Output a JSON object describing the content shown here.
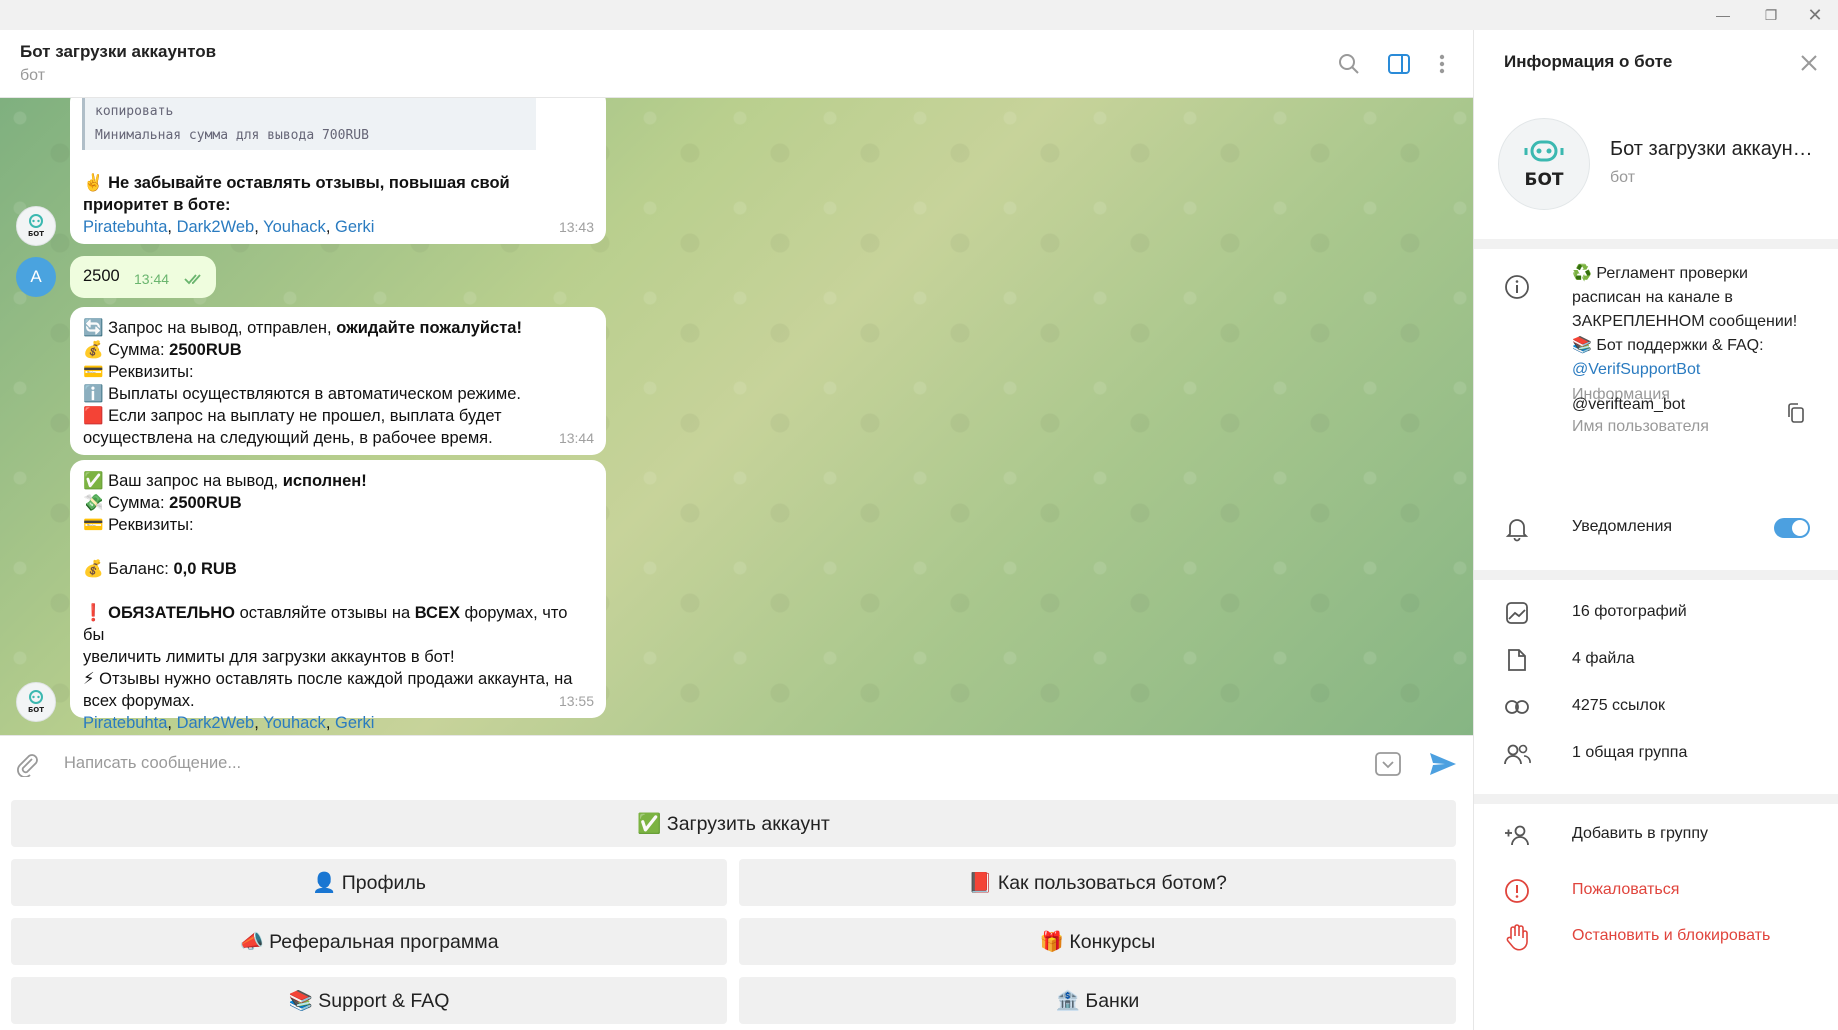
{
  "chat": {
    "title": "Бот загрузки аккаунтов",
    "subtitle": "бот"
  },
  "messages": {
    "m1": {
      "code_top": "копировать",
      "code_bottom": "Минимальная сумма для вывода 700RUB",
      "line1": "✌️ Не забывайте оставлять отзывы, повышая свой",
      "line2": "приоритет в боте:",
      "links": [
        "Piratebuhta",
        "Dark2Web",
        "Youhack",
        "Gerki"
      ],
      "time": "13:43"
    },
    "m2": {
      "text": "2500",
      "time": "13:44"
    },
    "m3": {
      "l1a": "🔄 Запрос на вывод,  отправлен, ",
      "l1b": "ожидайте пожалуйста!",
      "l2a": "💰 Сумма: ",
      "l2b": "2500RUB",
      "l3": "💳 Реквизиты: ",
      "l4": "ℹ️ Выплаты осуществляются в автоматическом режиме.",
      "l5": "🟥 Если запрос на выплату не прошел, выплата будет",
      "l6": "осуществлена на следующий день, в рабочее время.",
      "time": "13:44"
    },
    "m4": {
      "l1a": "✅ Ваш запрос на вывод, ",
      "l1b": "исполнен!",
      "l2a": "💸 Сумма: ",
      "l2b": "2500RUB",
      "l3": "💳 Реквизиты: ",
      "l4a": "💰 Баланс: ",
      "l4b": "0,0 RUB",
      "l5a": "❗ ",
      "l5b": "ОБЯЗАТЕЛЬНО",
      "l5c": " оставляйте отзывы на ",
      "l5d": "ВСЕХ",
      "l5e": " форумах, что бы",
      "l6": "увеличить лимиты для загрузки аккаунтов в бот!",
      "l7": "⚡ Отзывы нужно оставлять после каждой продажи аккаунта, на",
      "l8": "всех форумах.",
      "links": [
        "Piratebuhta",
        "Dark2Web",
        "Youhack",
        "Gerki"
      ],
      "time": "13:55"
    }
  },
  "user_avatar_letter": "A",
  "bot_avatar_text": "БОТ",
  "input": {
    "placeholder": "Написать сообщение..."
  },
  "keyboard": {
    "upload": "✅ Загрузить аккаунт",
    "profile": "👤 Профиль",
    "howto": "📕 Как пользоваться ботом?",
    "referral": "📣 Реферальная программа",
    "contests": "🎁 Конкурсы",
    "support": "📚 Support & FAQ",
    "banks": "🏦 Банки"
  },
  "panel": {
    "title": "Информация о боте",
    "bot_name": "Бот загрузки аккаунтов",
    "bot_role": "бот",
    "about_lines": [
      "♻️ Регламент проверки",
      "расписан на канале в",
      "ЗАКРЕПЛЕННОМ сообщении!",
      "📚 Бот поддержки & FAQ:"
    ],
    "about_link": "@VerifSupportBot",
    "about_label": "Информация",
    "username": "@verifteam_bot",
    "username_label": "Имя пользователя",
    "notifications": "Уведомления",
    "notifications_on": true,
    "photos": "16 фотографий",
    "files": "4 файла",
    "links": "4275 ссылок",
    "groups": "1 общая группа",
    "add_to_group": "Добавить в группу",
    "report": "Пожаловаться",
    "block": "Остановить и блокировать"
  },
  "colors": {
    "accent": "#4ca0e0",
    "link": "#2a7bc0",
    "danger": "#e0443c",
    "outgoing_bubble": "#effdde"
  }
}
